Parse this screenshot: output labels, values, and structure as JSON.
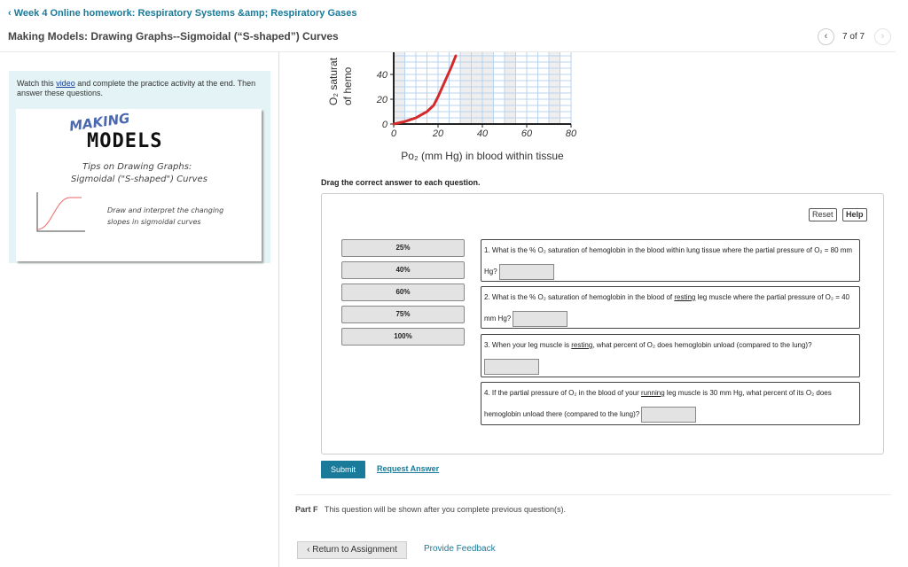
{
  "header": {
    "back_link": "Week 4 Online homework: Respiratory Systems &amp; Respiratory Gases",
    "title": "Making Models: Drawing Graphs--Sigmoidal (“S-shaped”) Curves",
    "pager": "7 of 7",
    "prev_icon": "chevron-left",
    "next_icon": "chevron-right"
  },
  "left": {
    "intro_before": "Watch this ",
    "intro_link": "video",
    "intro_after": " and complete the practice activity at the end. Then answer these questions.",
    "thumb": {
      "making": "MAKING",
      "models": "MODELS",
      "subtitle1": "Tips on Drawing Graphs:",
      "subtitle2": "Sigmoidal (\"S-shaped\") Curves",
      "desc1": "Draw and interpret the changing",
      "desc2": "slopes in sigmoidal curves"
    }
  },
  "graph": {
    "ylabel1": "O₂ saturat",
    "ylabel2": "of hemo",
    "xlabel": "Po₂ (mm Hg) in blood within tissue",
    "xticks": [
      "0",
      "20",
      "40",
      "60",
      "80"
    ],
    "yticks": [
      "0",
      "20",
      "40"
    ],
    "curve_color": "#d42a2a",
    "curve": [
      [
        0,
        0
      ],
      [
        5,
        2
      ],
      [
        10,
        5
      ],
      [
        15,
        10
      ],
      [
        18,
        15
      ],
      [
        20,
        22
      ],
      [
        22,
        30
      ],
      [
        24,
        38
      ],
      [
        26,
        46
      ],
      [
        28,
        55
      ]
    ]
  },
  "main": {
    "instruction": "Drag the correct answer to each question.",
    "reset": "Reset",
    "help": "Help",
    "answers": [
      "25%",
      "40%",
      "60%",
      "75%",
      "100%"
    ],
    "questions": [
      {
        "text": "1. What is the % O₂ saturation of hemoglobin in the blood within lung tissue where the partial pressure of O₂ = 80 mm Hg?"
      },
      {
        "pre": "2. What is the % O₂ saturation of hemoglobin in the blood of ",
        "u": "resting",
        "post": " leg muscle where the partial pressure of O₂ = 40 mm Hg?"
      },
      {
        "pre": "3. When your leg muscle is ",
        "u": "resting",
        "post": ", what percent of O₂ does hemoglobin unload (compared to the lung)?"
      },
      {
        "pre": "4. If the partial pressure of O₂ in the blood of your ",
        "u": "running",
        "post": " leg muscle is 30 mm Hg, what percent of its O₂ does hemoglobin unload there (compared to the lung)?"
      }
    ],
    "submit": "Submit",
    "request_answer": "Request Answer",
    "part_label": "Part F",
    "part_text": "This question will be shown after you complete previous question(s)."
  },
  "footer": {
    "return": "Return to Assignment",
    "feedback": "Provide Feedback"
  },
  "colors": {
    "accent": "#1a7a99",
    "panel": "#e4f4f6"
  }
}
